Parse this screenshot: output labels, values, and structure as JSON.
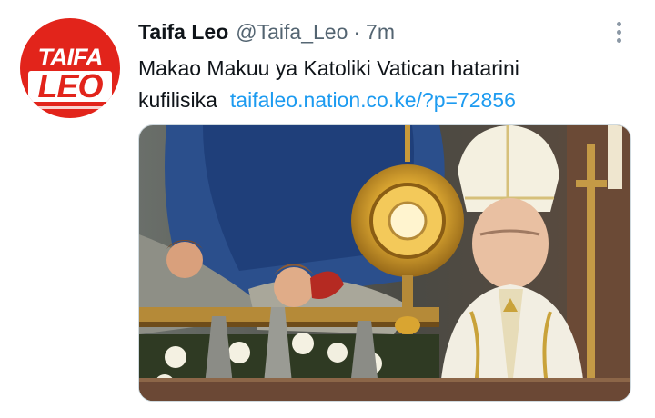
{
  "tweet": {
    "author_name": "Taifa Leo",
    "handle": "@Taifa_Leo",
    "separator": "·",
    "time": "7m",
    "text": "Makao Makuu ya Katoliki Vatican hatarini kufilisika",
    "link": "taifaleo.nation.co.ke/?p=72856"
  },
  "avatar": {
    "logo_line1": "TAIFA",
    "logo_line2": "LEO",
    "brand_color": "#e2241b"
  },
  "icons": {
    "more": "more-vertical-icon"
  },
  "colors": {
    "link": "#1d9bf0",
    "secondary_text": "#536471"
  }
}
